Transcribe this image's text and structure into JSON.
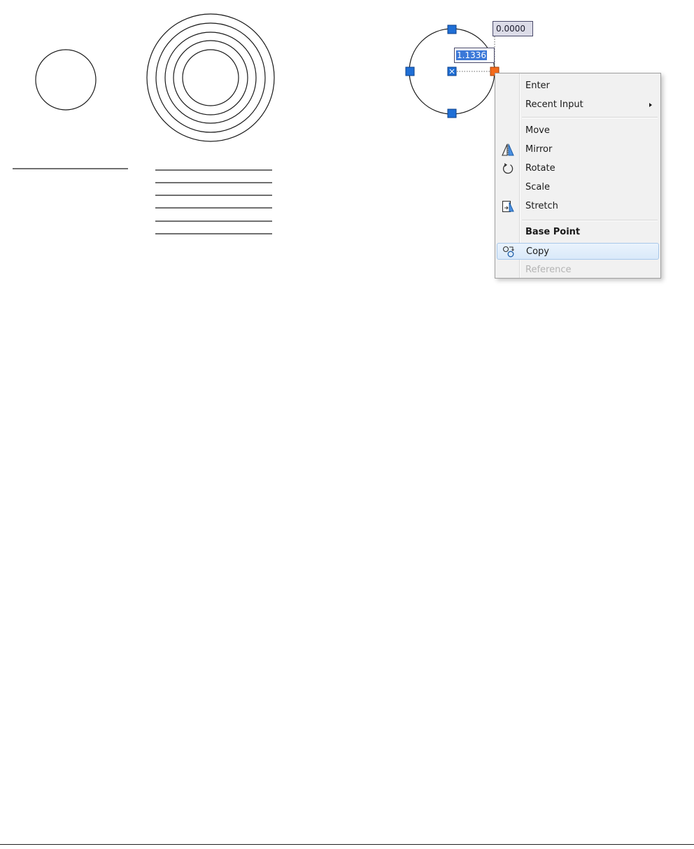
{
  "dynamic_input": {
    "angle_value": "0.0000",
    "radius_value": "1.1336"
  },
  "context_menu": {
    "items": [
      {
        "label": "Enter"
      },
      {
        "label": "Recent Input"
      },
      {
        "label": "Move"
      },
      {
        "label": "Mirror",
        "icon": "mirror-icon"
      },
      {
        "label": "Rotate",
        "icon": "rotate-icon"
      },
      {
        "label": "Scale"
      },
      {
        "label": "Stretch",
        "icon": "stretch-icon"
      },
      {
        "label": "Base Point"
      },
      {
        "label": "Copy",
        "icon": "copy-icon"
      },
      {
        "label": "Reference"
      }
    ]
  },
  "colors": {
    "grip": "#1f6fd6",
    "hot_grip": "#f26a1b",
    "highlight": "#3b78d8",
    "linework": "#1a1a1a"
  }
}
